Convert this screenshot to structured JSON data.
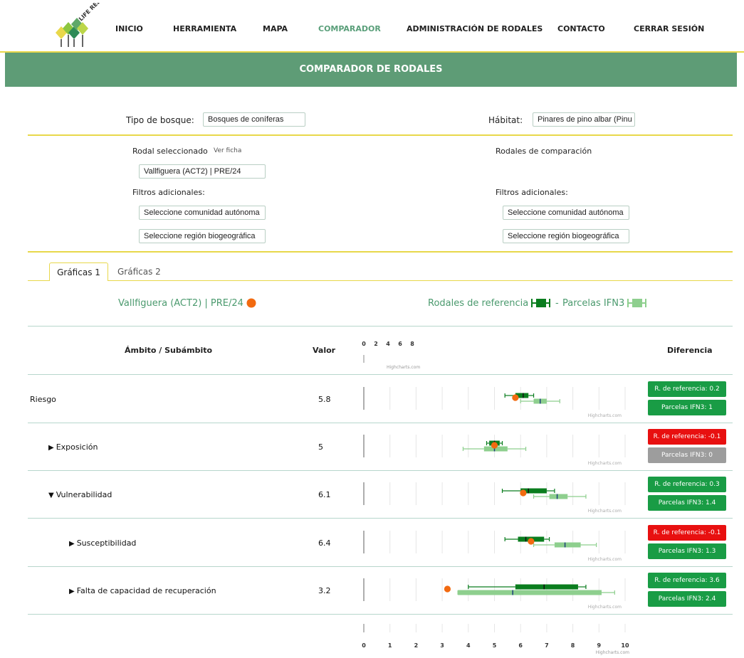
{
  "brand": {
    "logo_text": "LIFE RED BOSQUES CLIMA"
  },
  "nav": {
    "items": [
      "INICIO",
      "HERRAMIENTA",
      "MAPA",
      "COMPARADOR",
      "ADMINISTRACIÓN DE RODALES",
      "CONTACTO",
      "CERRAR SESIÓN"
    ],
    "active": "COMPARADOR"
  },
  "banner": {
    "title": "COMPARADOR DE RODALES"
  },
  "filters": {
    "forest_type_label": "Tipo de bosque:",
    "forest_type_value": "Bosques de coníferas",
    "habitat_label": "Hábitat:",
    "habitat_value": "Pinares de pino albar (Pinu"
  },
  "left": {
    "title": "Rodal seleccionado",
    "link": "Ver ficha",
    "selected": "Vallfiguera (ACT2) | PRE/24",
    "filters_label": "Filtros adicionales:",
    "comunidad_placeholder": "Seleccione comunidad autónoma",
    "region_placeholder": "Seleccione región biogeográfica"
  },
  "right": {
    "title": "Rodales de comparación",
    "filters_label": "Filtros adicionales:",
    "comunidad_placeholder": "Seleccione comunidad autónoma",
    "region_placeholder": "Seleccione región biogeográfica"
  },
  "tabs": {
    "tab1": "Gráficas 1",
    "tab2": "Gráficas 2"
  },
  "legend": {
    "selected": "Vallfiguera (ACT2) | PRE/24",
    "reference": "Rodales de referencia",
    "separator": "-",
    "ifn3": "Parcelas IFN3",
    "selected_color": "#f26a10",
    "reference_color": "#0a7d1e",
    "ifn3_color": "#8ecf8e"
  },
  "table": {
    "col_ambito": "Ámbito / Subámbito",
    "col_valor": "Valor",
    "col_diferencia": "Diferencia",
    "credit": "Highcharts.com",
    "header_ticks": [
      "0",
      "2",
      "4",
      "6",
      "8"
    ],
    "axis_ticks": [
      "0",
      "1",
      "2",
      "3",
      "4",
      "5",
      "6",
      "7",
      "8",
      "9",
      "10"
    ],
    "rows": [
      {
        "label": "Riesgo",
        "marker": "",
        "value": "5.8",
        "ref_text": "R. de referencia: 0.2",
        "ref_status": "green",
        "ifn_text": "Parcelas IFN3: 1",
        "ifn_status": "green"
      },
      {
        "label": "Exposición",
        "marker": "▶",
        "value": "5",
        "ref_text": "R. de referencia: -0.1",
        "ref_status": "red",
        "ifn_text": "Parcelas IFN3: 0",
        "ifn_status": "grey"
      },
      {
        "label": "Vulnerabilidad",
        "marker": "▼",
        "value": "6.1",
        "ref_text": "R. de referencia: 0.3",
        "ref_status": "green",
        "ifn_text": "Parcelas IFN3: 1.4",
        "ifn_status": "green"
      },
      {
        "label": "Susceptibilidad",
        "marker": "▶",
        "value": "6.4",
        "ref_text": "R. de referencia: -0.1",
        "ref_status": "red",
        "ifn_text": "Parcelas IFN3: 1.3",
        "ifn_status": "green"
      },
      {
        "label": "Falta de capacidad de recuperación",
        "marker": "▶",
        "value": "3.2",
        "ref_text": "R. de referencia: 3.6",
        "ref_status": "green",
        "ifn_text": "Parcelas IFN3: 2.4",
        "ifn_status": "green"
      }
    ]
  },
  "chart_data": {
    "type": "boxplot",
    "xlim": [
      0,
      10
    ],
    "rows": [
      {
        "ambito": "Riesgo",
        "selected": 5.8,
        "reference": {
          "min": 5.4,
          "q1": 5.8,
          "median": 6.1,
          "q3": 6.3,
          "max": 6.5
        },
        "ifn3": {
          "min": 6.0,
          "q1": 6.5,
          "median": 6.75,
          "q3": 7.0,
          "max": 7.5
        }
      },
      {
        "ambito": "Exposición",
        "selected": 5.0,
        "reference": {
          "min": 4.7,
          "q1": 4.8,
          "median": 5.0,
          "q3": 5.2,
          "max": 5.3
        },
        "ifn3": {
          "min": 3.8,
          "q1": 4.6,
          "median": 5.0,
          "q3": 5.5,
          "max": 6.2
        }
      },
      {
        "ambito": "Vulnerabilidad",
        "selected": 6.1,
        "reference": {
          "min": 5.3,
          "q1": 6.0,
          "median": 6.3,
          "q3": 7.0,
          "max": 7.3
        },
        "ifn3": {
          "min": 6.5,
          "q1": 7.1,
          "median": 7.4,
          "q3": 7.8,
          "max": 8.5
        }
      },
      {
        "ambito": "Susceptibilidad",
        "selected": 6.4,
        "reference": {
          "min": 5.4,
          "q1": 5.9,
          "median": 6.2,
          "q3": 6.9,
          "max": 7.1
        },
        "ifn3": {
          "min": 6.5,
          "q1": 7.3,
          "median": 7.7,
          "q3": 8.3,
          "max": 8.9
        }
      },
      {
        "ambito": "Falta de capacidad de recuperación",
        "selected": 3.2,
        "reference": {
          "min": 4.0,
          "q1": 5.8,
          "median": 6.9,
          "q3": 8.2,
          "max": 8.5
        },
        "ifn3": {
          "min": 3.6,
          "q1": 3.6,
          "median": 5.7,
          "q3": 9.1,
          "max": 9.6
        }
      }
    ]
  }
}
